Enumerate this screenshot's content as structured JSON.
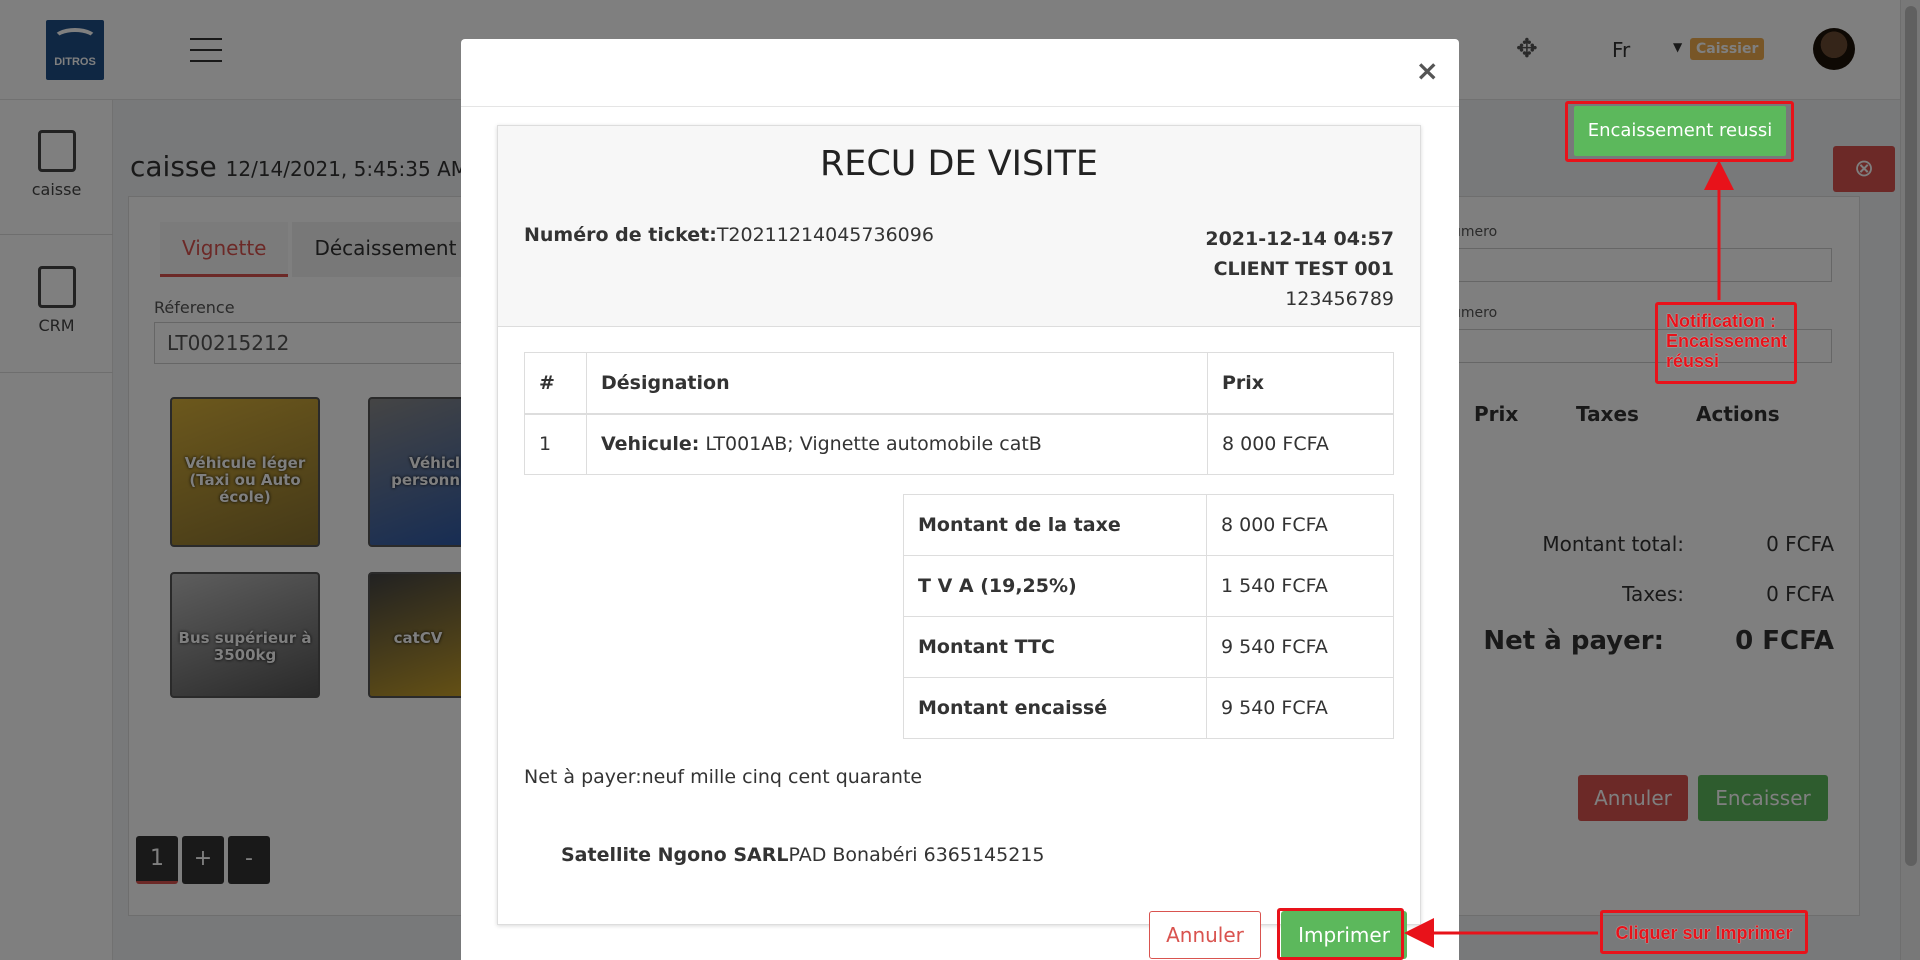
{
  "app": {
    "logo_text": "DITROS",
    "language": "Fr",
    "role_badge": "Caissier"
  },
  "sidebar": {
    "items": [
      {
        "label": "caisse",
        "icon": "cash-register-icon"
      },
      {
        "label": "CRM",
        "icon": "book-icon"
      }
    ]
  },
  "page": {
    "title": "caisse",
    "datetime": "12/14/2021, 5:45:35 AM |",
    "tabs": [
      "Vignette",
      "Décaissement"
    ],
    "reference_label": "Réference",
    "reference_value": "LT00215212",
    "vehicle_tiles": [
      "Véhicule léger (Taxi ou Auto école)",
      "Véhicl personn",
      "Bus supérieur à 3500kg",
      "catCV"
    ],
    "field_label_1": "umero",
    "field_label_2": "umero",
    "columns": [
      "Prix",
      "Taxes",
      "Actions"
    ],
    "summary": {
      "total_label": "Montant total:",
      "total_value": "0 FCFA",
      "taxes_label": "Taxes:",
      "taxes_value": "0 FCFA",
      "net_label": "Net à payer:",
      "net_value": "0 FCFA"
    },
    "cancel_label": "Annuler",
    "encaisser_label": "Encaisser",
    "stepper": {
      "current": "1",
      "plus": "+",
      "minus": "-"
    }
  },
  "modal": {
    "close": "×",
    "title": "RECU DE VISITE",
    "ticket_label": "Numéro de ticket:",
    "ticket_value": "T20211214045736096",
    "date": "2021-12-14 04:57",
    "client": "CLIENT TEST 001",
    "phone": "123456789",
    "table": {
      "headers": [
        "#",
        "Désignation",
        "Prix"
      ],
      "rows": [
        {
          "num": "1",
          "designation_bold": "Vehicule:",
          "designation": " LT001AB; Vignette automobile catB",
          "price": "8 000 FCFA"
        }
      ]
    },
    "totals": [
      {
        "label": "Montant de la taxe",
        "value": "8 000 FCFA"
      },
      {
        "label": "T V A (19,25%)",
        "value": "1 540 FCFA"
      },
      {
        "label": "Montant TTC",
        "value": "9 540 FCFA"
      },
      {
        "label": "Montant encaissé",
        "value": "9 540 FCFA"
      }
    ],
    "net_words": "Net à payer:neuf mille cinq cent quarante",
    "company_name": "Satellite Ngono SARL",
    "company_info": "PAD Bonabéri 6365145215",
    "cancel_label": "Annuler",
    "print_label": "Imprimer"
  },
  "notification": {
    "toast_text": "Encaissement reussi",
    "callout_notification": "Notification : Encaissement réussi",
    "callout_print": "Cliquer sur Imprimer"
  },
  "colors": {
    "success": "#5cb85c",
    "danger": "#d9534f",
    "annotation": "#e8121a",
    "badge": "#f0ad4e"
  }
}
